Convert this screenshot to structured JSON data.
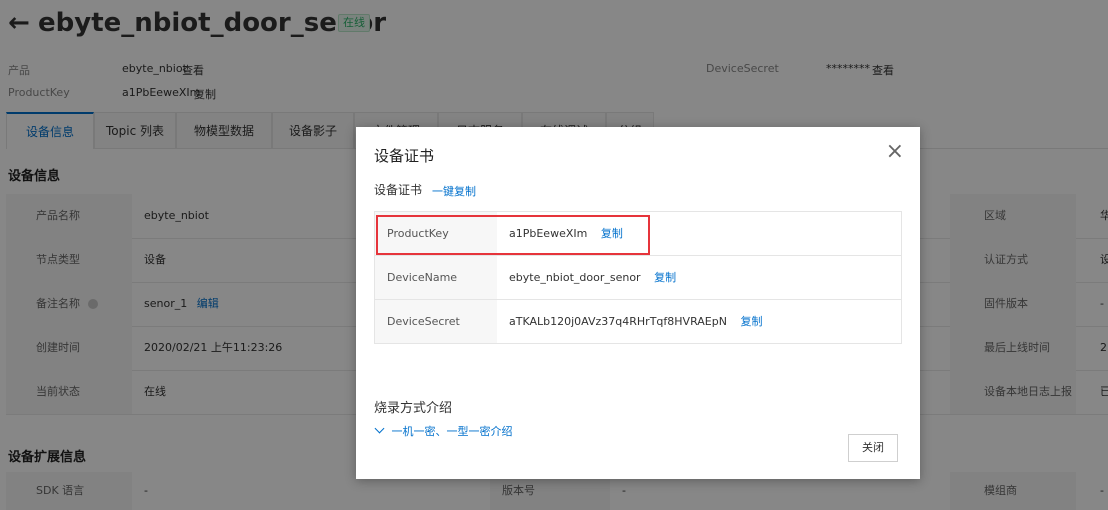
{
  "header": {
    "back_glyph": "←",
    "device_name": "ebyte_nbiot_door_senor",
    "status_badge": "在线",
    "product_label": "产品",
    "product_value": "ebyte_nbiot",
    "product_view_link": "查看",
    "productkey_label": "ProductKey",
    "productkey_value": "a1PbEeweXIm",
    "productkey_copy": "复制",
    "devicesecret_label": "DeviceSecret",
    "devicesecret_value": "********",
    "devicesecret_view": "查看"
  },
  "tabs": [
    {
      "label": "设备信息",
      "active": true
    },
    {
      "label": "Topic 列表"
    },
    {
      "label": "物模型数据"
    },
    {
      "label": "设备影子"
    },
    {
      "label": "文件管理"
    },
    {
      "label": "日志服务"
    },
    {
      "label": "在线调试"
    },
    {
      "label": "分组"
    }
  ],
  "device_info": {
    "section_title": "设备信息",
    "rows": [
      {
        "label": "产品名称",
        "value": "ebyte_nbiot",
        "right_label": "区域",
        "right_value": "华"
      },
      {
        "label": "节点类型",
        "value": "设备",
        "right_label": "认证方式",
        "right_value": "设"
      },
      {
        "label": "备注名称",
        "value": "senor_1",
        "edit": "编辑",
        "right_label": "固件版本",
        "right_value": "-"
      },
      {
        "label": "创建时间",
        "value": "2020/02/21 上午11:23:26",
        "right_label": "最后上线时间",
        "right_value": "2"
      },
      {
        "label": "当前状态",
        "value": "在线",
        "right_label": "设备本地日志上报",
        "right_value": "已"
      }
    ]
  },
  "ext_info": {
    "section_title": "设备扩展信息",
    "row": {
      "label": "SDK 语言",
      "value": "-",
      "mid_label": "版本号",
      "mid_value": "-",
      "right_label": "模组商",
      "right_value": "-"
    }
  },
  "modal": {
    "title": "设备证书",
    "close_glyph": "×",
    "cert_heading": "设备证书",
    "copy_all": "一键复制",
    "rows": [
      {
        "key": "ProductKey",
        "value": "a1PbEeweXIm",
        "copy": "复制"
      },
      {
        "key": "DeviceName",
        "value": "ebyte_nbiot_door_senor",
        "copy": "复制"
      },
      {
        "key": "DeviceSecret",
        "value": "aTKALb120j0AVz37q4RHrTqf8HVRAEpN",
        "copy": "复制"
      }
    ],
    "burn_title": "烧录方式介绍",
    "burn_link": "一机一密、一型一密介绍",
    "close_button": "关闭"
  },
  "colors": {
    "link": "#0070cc",
    "highlight": "#e6343b",
    "online": "#2db36a"
  }
}
